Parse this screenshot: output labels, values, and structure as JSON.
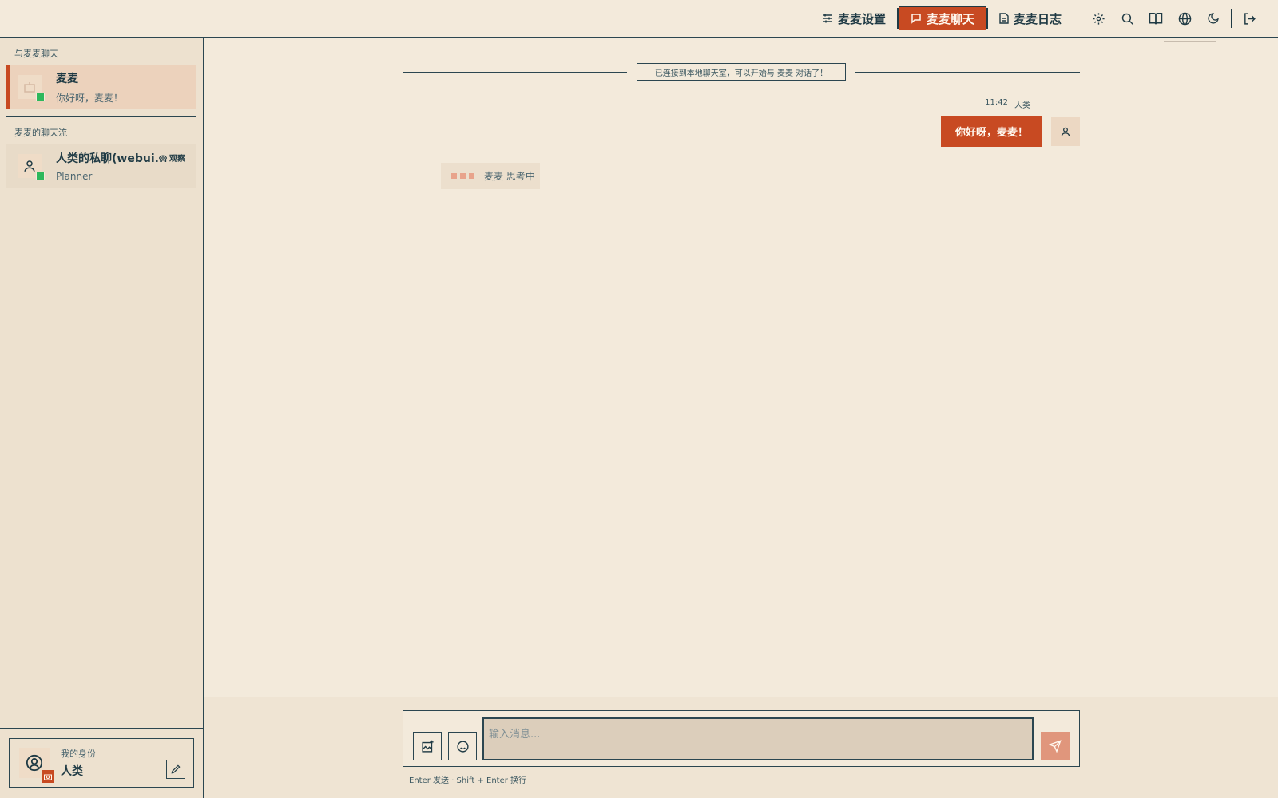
{
  "nav": {
    "settings_label": "麦麦设置",
    "chat_label": "麦麦聊天",
    "log_label": "麦麦日志",
    "icons": [
      "gear-icon",
      "search-icon",
      "book-icon",
      "globe-icon",
      "moon-icon",
      "logout-icon"
    ]
  },
  "sidebar": {
    "section_chat": "与麦麦聊天",
    "bot_chat": {
      "name": "麦麦",
      "preview": "你好呀，麦麦！"
    },
    "section_streams": "麦麦的聊天流",
    "stream": {
      "name": "人类的私聊(webui...",
      "sub": "Planner",
      "observe_label": "观察"
    },
    "identity": {
      "label": "我的身份",
      "name": "人类"
    }
  },
  "chat": {
    "system_message": "已连接到本地聊天室，可以开始与 麦麦 对话了！",
    "message": {
      "time": "11:42",
      "sender": "人类",
      "text": "你好呀，麦麦！"
    },
    "thinking": "麦麦 思考中"
  },
  "composer": {
    "placeholder": "输入消息...",
    "hint": "Enter 发送 · Shift + Enter 换行"
  },
  "colors": {
    "accent": "#c84a22",
    "online": "#2eb85c",
    "background": "#f3eadb",
    "ink": "#1f3a44"
  }
}
